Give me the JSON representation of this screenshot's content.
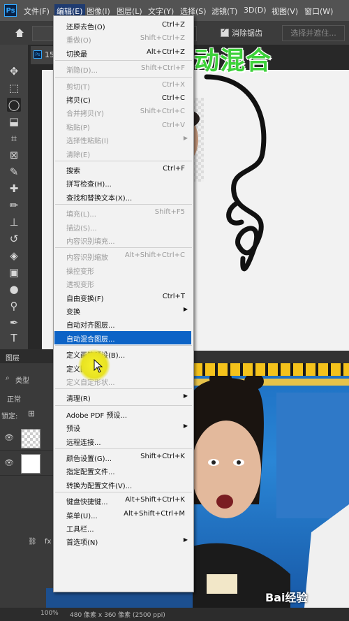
{
  "menubar": {
    "items": [
      "文件(F)",
      "编辑(E)",
      "图像(I)",
      "图层(L)",
      "文字(Y)",
      "选择(S)",
      "滤镜(T)",
      "3D(D)",
      "视图(V)",
      "窗口(W)"
    ],
    "active_index": 1
  },
  "options_bar": {
    "antialias_label": "消除锯齿",
    "select_subject_button": "选择并遮住..."
  },
  "document_tab": {
    "label": "15"
  },
  "overlay_title": "编辑+自动混合",
  "layers_panel": {
    "tab_label": "图层",
    "filter_label": "类型",
    "blend_mode": "正常",
    "lock_label": "锁定:"
  },
  "status_bar": {
    "zoom": "100%",
    "doc_info": "480 像素 x 360 像素 (2500 ppi)"
  },
  "edit_menu": {
    "items": [
      {
        "label": "还原去色(O)",
        "shortcut": "Ctrl+Z",
        "disabled": false
      },
      {
        "label": "重做(O)",
        "shortcut": "Shift+Ctrl+Z",
        "disabled": true
      },
      {
        "label": "切换最",
        "shortcut": "Alt+Ctrl+Z",
        "disabled": false
      },
      {
        "sep": true
      },
      {
        "label": "渐隐(D)...",
        "shortcut": "Shift+Ctrl+F",
        "disabled": true
      },
      {
        "sep": true
      },
      {
        "label": "剪切(T)",
        "shortcut": "Ctrl+X",
        "disabled": true
      },
      {
        "label": "拷贝(C)",
        "shortcut": "Ctrl+C",
        "disabled": false
      },
      {
        "label": "合并拷贝(Y)",
        "shortcut": "Shift+Ctrl+C",
        "disabled": true
      },
      {
        "label": "粘贴(P)",
        "shortcut": "Ctrl+V",
        "disabled": true
      },
      {
        "label": "选择性粘贴(I)",
        "shortcut": "",
        "disabled": true,
        "submenu": true
      },
      {
        "label": "清除(E)",
        "shortcut": "",
        "disabled": true
      },
      {
        "sep": true
      },
      {
        "label": "搜索",
        "shortcut": "Ctrl+F",
        "disabled": false
      },
      {
        "label": "拼写检查(H)...",
        "shortcut": "",
        "disabled": false
      },
      {
        "label": "查找和替换文本(X)...",
        "shortcut": "",
        "disabled": false
      },
      {
        "sep": true
      },
      {
        "label": "填充(L)...",
        "shortcut": "Shift+F5",
        "disabled": true
      },
      {
        "label": "描边(S)...",
        "shortcut": "",
        "disabled": true
      },
      {
        "label": "内容识别填充...",
        "shortcut": "",
        "disabled": true
      },
      {
        "sep": true
      },
      {
        "label": "内容识别缩放",
        "shortcut": "Alt+Shift+Ctrl+C",
        "disabled": true
      },
      {
        "label": "操控变形",
        "shortcut": "",
        "disabled": true
      },
      {
        "label": "透视变形",
        "shortcut": "",
        "disabled": true
      },
      {
        "label": "自由变换(F)",
        "shortcut": "Ctrl+T",
        "disabled": false
      },
      {
        "label": "变换",
        "shortcut": "",
        "disabled": false,
        "submenu": true
      },
      {
        "label": "自动对齐图层...",
        "shortcut": "",
        "disabled": false
      },
      {
        "label": "自动混合图层...",
        "shortcut": "",
        "disabled": false,
        "highlighted": true
      },
      {
        "sep": true
      },
      {
        "label": "定义画笔预设(B)...",
        "shortcut": "",
        "disabled": false
      },
      {
        "label": "定义图案...",
        "shortcut": "",
        "disabled": false
      },
      {
        "label": "定义自定形状...",
        "shortcut": "",
        "disabled": true
      },
      {
        "sep": true
      },
      {
        "label": "清理(R)",
        "shortcut": "",
        "disabled": false,
        "submenu": true
      },
      {
        "sep": true
      },
      {
        "label": "Adobe PDF 预设...",
        "shortcut": "",
        "disabled": false
      },
      {
        "label": "预设",
        "shortcut": "",
        "disabled": false,
        "submenu": true
      },
      {
        "label": "远程连接...",
        "shortcut": "",
        "disabled": false
      },
      {
        "sep": true
      },
      {
        "label": "颜色设置(G)...",
        "shortcut": "Shift+Ctrl+K",
        "disabled": false
      },
      {
        "label": "指定配置文件...",
        "shortcut": "",
        "disabled": false
      },
      {
        "label": "转换为配置文件(V)...",
        "shortcut": "",
        "disabled": false
      },
      {
        "sep": true
      },
      {
        "label": "键盘快捷键...",
        "shortcut": "Alt+Shift+Ctrl+K",
        "disabled": false
      },
      {
        "label": "菜单(U)...",
        "shortcut": "Alt+Shift+Ctrl+M",
        "disabled": false
      },
      {
        "label": "工具栏...",
        "shortcut": "",
        "disabled": false
      },
      {
        "label": "首选项(N)",
        "shortcut": "",
        "disabled": false,
        "submenu": true
      }
    ]
  },
  "watermark": "Bai经验",
  "colors": {
    "highlight": "#0c63c6",
    "overlay_green": "#3dd23a"
  }
}
